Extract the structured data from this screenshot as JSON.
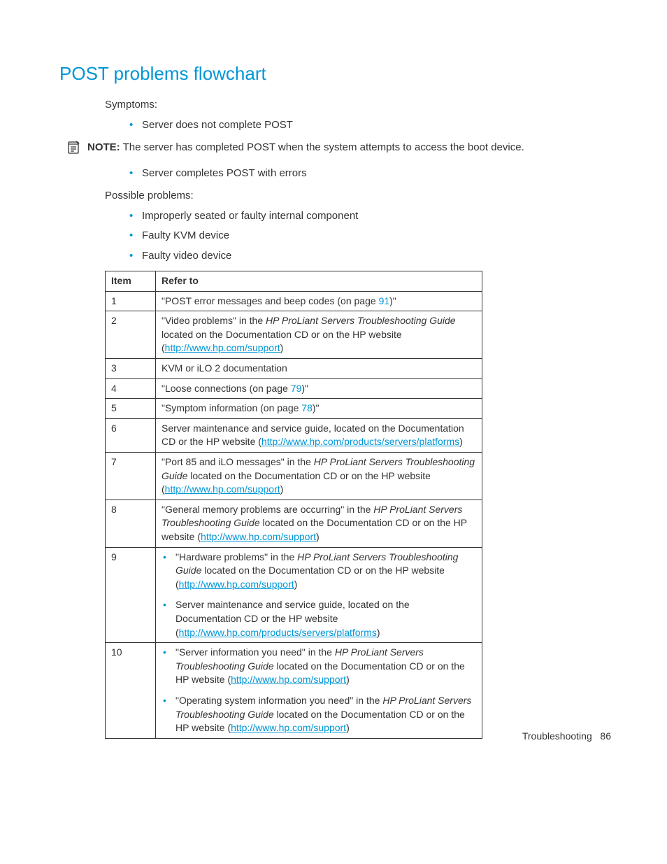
{
  "heading": "POST problems flowchart",
  "symptoms_label": "Symptoms:",
  "symptoms": [
    "Server does not complete POST"
  ],
  "note": {
    "label": "NOTE:",
    "text": "The server has completed POST when the system attempts to access the boot device."
  },
  "symptoms2": [
    "Server completes POST with errors"
  ],
  "possible_label": "Possible problems:",
  "possible": [
    "Improperly seated or faulty internal component",
    "Faulty KVM device",
    "Faulty video device"
  ],
  "table": {
    "headers": {
      "item": "Item",
      "refer": "Refer to"
    },
    "rows": {
      "r1": {
        "item": "1",
        "pre": "\"POST error messages and beep codes (on page ",
        "page": "91",
        "post": ")\""
      },
      "r2": {
        "item": "2",
        "pre": "\"Video problems\" in the ",
        "guide": "HP ProLiant Servers Troubleshooting Guide",
        "mid": " located on the Documentation CD or on the HP website (",
        "link": "http://www.hp.com/support",
        "post": ")"
      },
      "r3": {
        "item": "3",
        "text": "KVM or iLO 2 documentation"
      },
      "r4": {
        "item": "4",
        "pre": "\"Loose connections (on page ",
        "page": "79",
        "post": ")\""
      },
      "r5": {
        "item": "5",
        "pre": "\"Symptom information (on page ",
        "page": "78",
        "post": ")\""
      },
      "r6": {
        "item": "6",
        "pre": "Server maintenance and service guide, located on the Documentation CD or the HP website (",
        "link": "http://www.hp.com/products/servers/platforms",
        "post": ")"
      },
      "r7": {
        "item": "7",
        "pre": "\"Port 85 and iLO messages\" in the ",
        "guide": "HP ProLiant Servers Troubleshooting Guide",
        "mid": " located on the Documentation CD or on the HP website (",
        "link": "http://www.hp.com/support",
        "post": ")"
      },
      "r8": {
        "item": "8",
        "pre": "\"General memory problems are occurring\" in the ",
        "guide": "HP ProLiant Servers Troubleshooting Guide",
        "mid": " located on the Documentation CD or on the HP website (",
        "link": "http://www.hp.com/support",
        "post": ")"
      },
      "r9": {
        "item": "9",
        "b1": {
          "pre": "\"Hardware problems\" in the ",
          "guide": "HP ProLiant Servers Troubleshooting Guide",
          "mid": " located on the Documentation CD or on the HP website (",
          "link": "http://www.hp.com/support",
          "post": ")"
        },
        "b2": {
          "pre": "Server maintenance and service guide, located on the Documentation CD or the HP website (",
          "link": "http://www.hp.com/products/servers/platforms",
          "post": ")"
        }
      },
      "r10": {
        "item": "10",
        "b1": {
          "pre": "\"Server information you need\" in the ",
          "guide": "HP ProLiant Servers Troubleshooting Guide",
          "mid": " located on the Documentation CD or on the HP website (",
          "link": "http://www.hp.com/support",
          "post": ")"
        },
        "b2": {
          "pre": "\"Operating system information you need\" in the ",
          "guide": "HP ProLiant Servers Troubleshooting Guide",
          "mid": " located on the Documentation CD or on the HP website (",
          "link": "http://www.hp.com/support",
          "post": ")"
        }
      }
    }
  },
  "footer": {
    "section": "Troubleshooting",
    "page": "86"
  }
}
